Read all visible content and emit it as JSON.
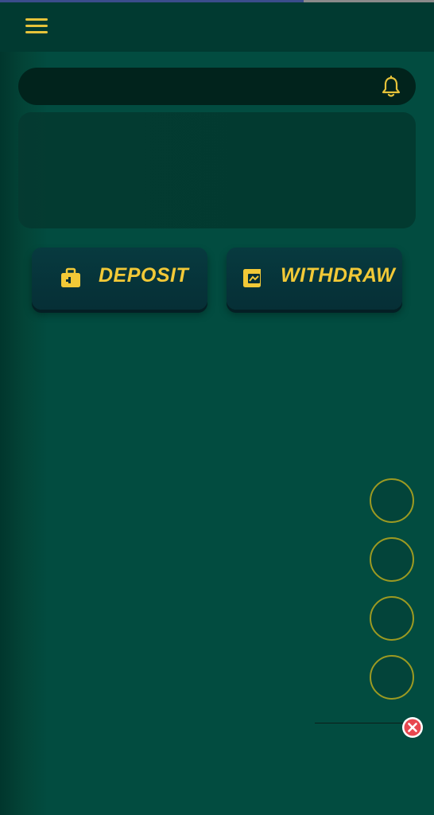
{
  "header": {
    "menu_icon": "hamburger-menu-icon"
  },
  "notice_bar": {
    "icon": "bell-icon"
  },
  "actions": {
    "deposit_label": "DEPOSIT",
    "deposit_icon": "briefcase-icon",
    "withdraw_label": "WITHDRAW",
    "withdraw_icon": "wallet-icon"
  },
  "floating_buttons": {
    "count": 4
  },
  "close": {
    "icon": "close-icon"
  },
  "colors": {
    "background": "#024c40",
    "header": "#013a31",
    "accent_yellow": "#f2c937",
    "button_bg": "#073a3f",
    "float_border": "#9c9a22",
    "close_red": "#e8474f"
  }
}
